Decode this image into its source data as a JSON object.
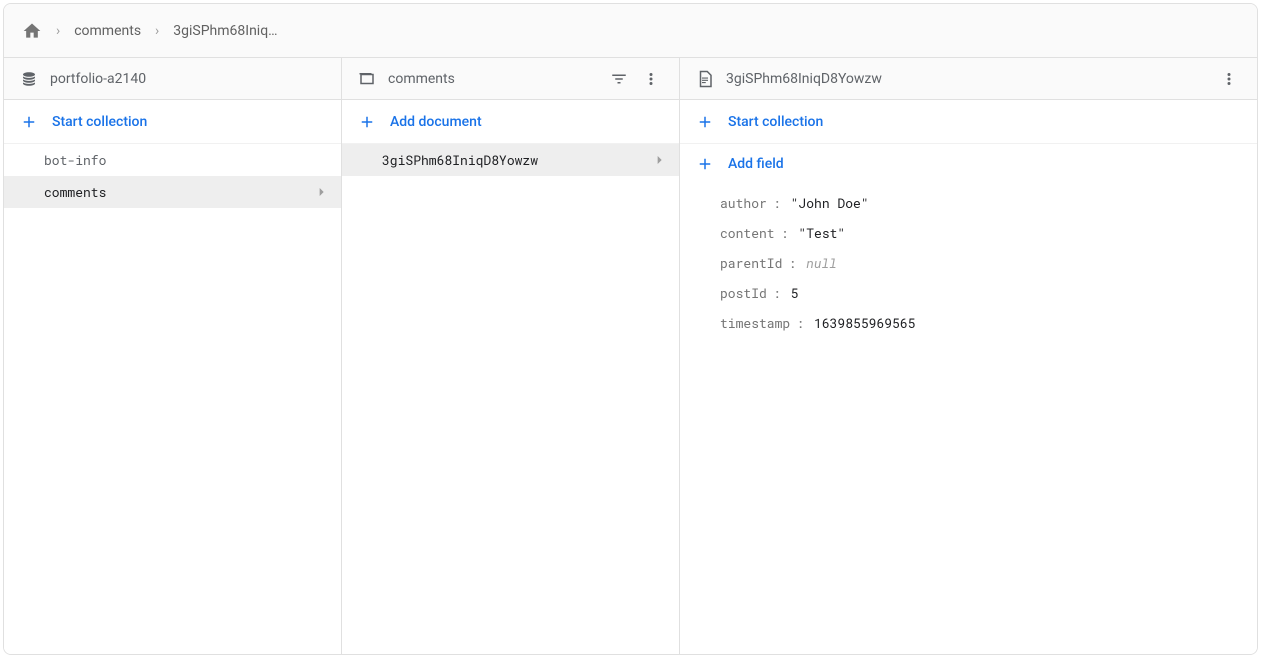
{
  "breadcrumb": {
    "items": [
      "comments",
      "3giSPhm68Iniq…"
    ]
  },
  "column_db": {
    "title": "portfolio-a2140",
    "start_label": "Start collection",
    "items": [
      {
        "label": "bot-info",
        "selected": false
      },
      {
        "label": "comments",
        "selected": true
      }
    ]
  },
  "column_coll": {
    "title": "comments",
    "start_label": "Add document",
    "items": [
      {
        "label": "3giSPhm68IniqD8Yowzw",
        "selected": true
      }
    ]
  },
  "column_doc": {
    "title": "3giSPhm68IniqD8Yowzw",
    "start_label": "Start collection",
    "add_field_label": "Add field",
    "fields": [
      {
        "key": "author",
        "value": "\"John Doe\"",
        "type": "string"
      },
      {
        "key": "content",
        "value": "\"Test\"",
        "type": "string"
      },
      {
        "key": "parentId",
        "value": "null",
        "type": "null"
      },
      {
        "key": "postId",
        "value": "5",
        "type": "number"
      },
      {
        "key": "timestamp",
        "value": "1639855969565",
        "type": "number"
      }
    ]
  }
}
